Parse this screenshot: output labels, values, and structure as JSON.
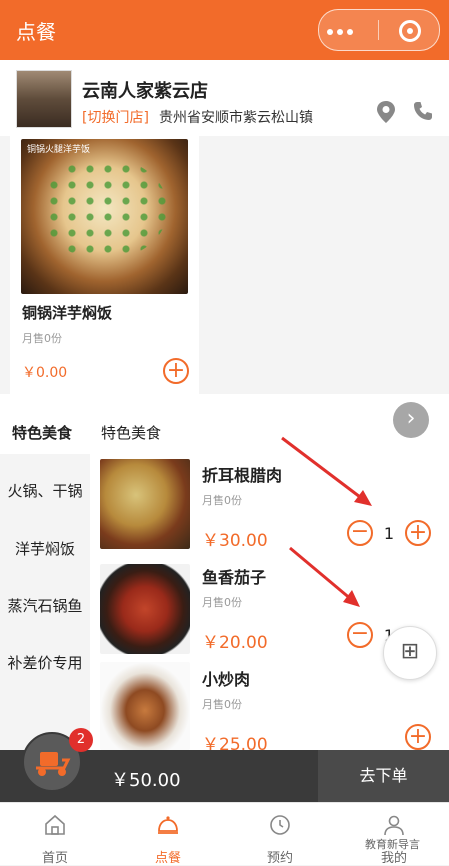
{
  "header": {
    "title": "点餐"
  },
  "shop": {
    "name": "云南人家紫云店",
    "switch_label": "[切换门店]",
    "address": "贵州省安顺市紫云松山镇"
  },
  "featured": {
    "image_caption": "铜锅火腿洋芋饭",
    "name": "铜锅洋芋焖饭",
    "sold": "月售0份",
    "price": "￥0.00"
  },
  "tabs": {
    "active": "特色美食",
    "second": "特色美食"
  },
  "sidebar": {
    "items": [
      {
        "label": "火锅、干锅"
      },
      {
        "label": "洋芋焖饭"
      },
      {
        "label": "蒸汽石锅鱼"
      },
      {
        "label": "补差价专用"
      }
    ]
  },
  "dishes": [
    {
      "name": "折耳根腊肉",
      "sold": "月售0份",
      "price": "￥30.00",
      "qty": "1"
    },
    {
      "name": "鱼香茄子",
      "sold": "月售0份",
      "price": "￥20.00",
      "qty": "1"
    },
    {
      "name": "小炒肉",
      "sold": "月售0份",
      "price": "￥25.00",
      "qty": ""
    }
  ],
  "cart": {
    "badge": "2",
    "total": "￥50.00",
    "checkout": "去下单"
  },
  "nav": [
    {
      "label": "首页",
      "active": false
    },
    {
      "label": "点餐",
      "active": true
    },
    {
      "label": "预约",
      "active": false
    },
    {
      "label": "我的",
      "active": false
    }
  ],
  "float_button": {
    "glyph": "⊞"
  },
  "watermark": "教育新导言",
  "colors": {
    "accent": "#f26b2a",
    "dark": "#3a3a3a",
    "badge": "#e1302c",
    "annotation": "#e1302c"
  }
}
